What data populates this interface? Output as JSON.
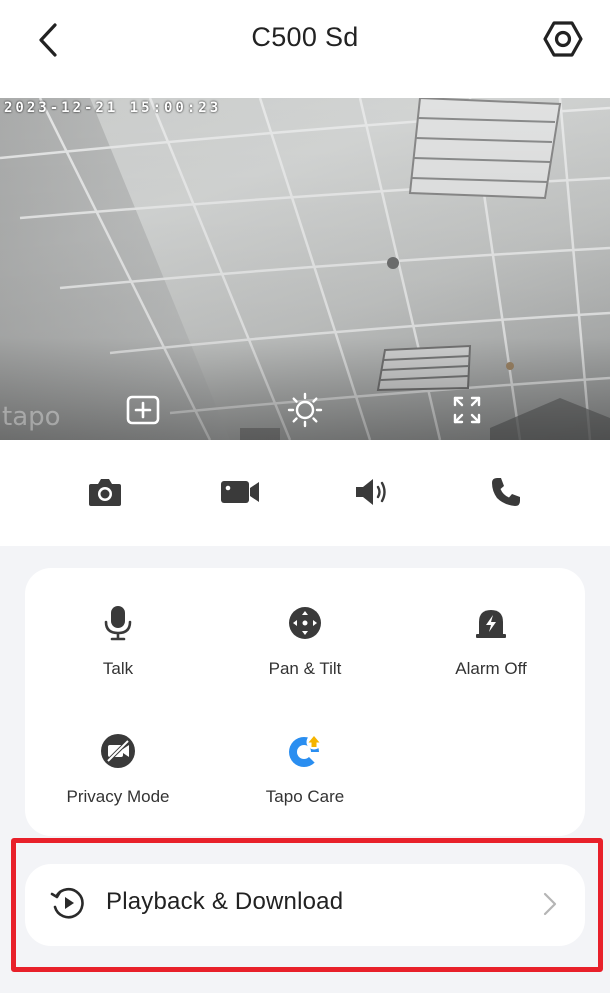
{
  "header": {
    "title": "C500 Sd",
    "back_icon": "chevron-left-icon",
    "settings_icon": "hexagon-settings-icon"
  },
  "live_view": {
    "timestamp": "2023-12-21 15:00:23",
    "watermark": "tapo",
    "controls": [
      {
        "name": "add-view-icon"
      },
      {
        "name": "brightness-icon"
      },
      {
        "name": "fullscreen-icon"
      }
    ]
  },
  "quick_actions": [
    {
      "name": "snapshot-camera-icon"
    },
    {
      "name": "record-video-icon"
    },
    {
      "name": "speaker-icon"
    },
    {
      "name": "phone-call-icon"
    }
  ],
  "features": [
    {
      "label": "Talk",
      "icon": "microphone-icon"
    },
    {
      "label": "Pan & Tilt",
      "icon": "pan-tilt-icon"
    },
    {
      "label": "Alarm Off",
      "icon": "alarm-siren-icon"
    },
    {
      "label": "Privacy Mode",
      "icon": "privacy-camera-off-icon"
    },
    {
      "label": "Tapo Care",
      "icon": "tapo-care-icon"
    }
  ],
  "playback": {
    "label": "Playback & Download",
    "icon": "playback-history-icon",
    "chevron": "chevron-right-icon"
  },
  "colors": {
    "highlight_border": "#e8202a",
    "background": "#f3f4f7",
    "card": "#ffffff",
    "tapo_care_blue": "#2a8ef0",
    "tapo_care_badge": "#f5b400"
  }
}
